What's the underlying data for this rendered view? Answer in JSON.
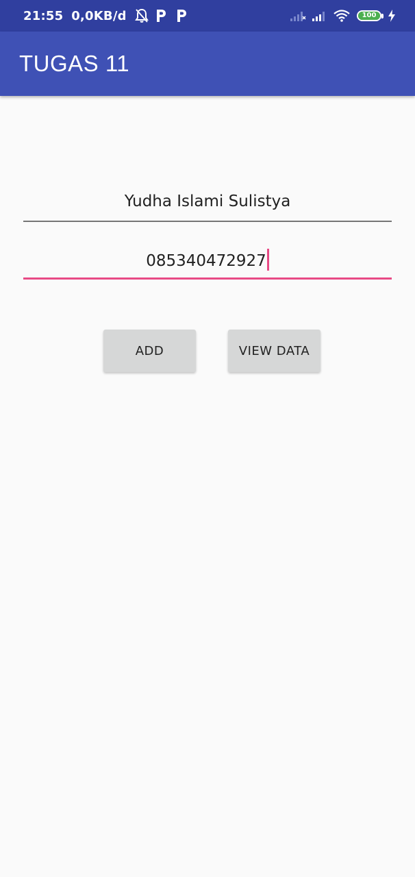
{
  "status_bar": {
    "time": "21:55",
    "network_speed": "0,0KB/d",
    "notification_icons": [
      "bell-off-icon",
      "parking-p-icon",
      "parking-p-icon"
    ],
    "system_icons": [
      "signal-no-service-icon",
      "signal-icon",
      "wifi-icon",
      "battery-icon",
      "charging-bolt-icon"
    ],
    "battery_level": "100",
    "battery_color": "#4caf50",
    "color": "#303f9f"
  },
  "app_bar": {
    "title": "TUGAS 11",
    "color": "#3f51b5"
  },
  "form": {
    "name_value": "Yudha Islami Sulistya",
    "phone_value": "085340472927",
    "accent_color": "#e84a85"
  },
  "buttons": {
    "add_label": "ADD",
    "view_data_label": "VIEW DATA"
  }
}
